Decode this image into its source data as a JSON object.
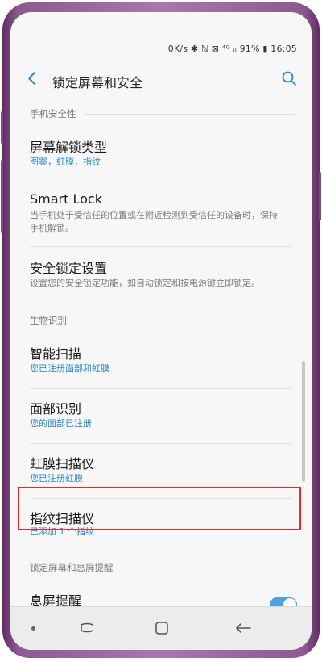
{
  "status_bar": {
    "text": "0K/s ✱ ℕ ⊠ ⁴ᴳ ᵢₗ 91% ▮ 16:05"
  },
  "header": {
    "title": "锁定屏幕和安全"
  },
  "sections": {
    "phone_security": "手机安全性",
    "biometrics": "生物识别",
    "lock_screen": "锁定屏幕和息屏提醒"
  },
  "items": [
    {
      "title": "屏幕解锁类型",
      "subtitle": "图案，虹膜，指纹"
    },
    {
      "title": "Smart Lock",
      "subtitle": "当手机处于受信任的位置或在附近检测到受信任的设备时，保持手机解锁。"
    },
    {
      "title": "安全锁定设置",
      "subtitle": "设置您的安全锁定功能，如自动锁定和按电源键立即锁定。"
    },
    {
      "title": "智能扫描",
      "subtitle": "您已注册面部和虹膜"
    },
    {
      "title": "面部识别",
      "subtitle": "您的面部已注册"
    },
    {
      "title": "虹膜扫描仪",
      "subtitle": "您已注册虹膜"
    },
    {
      "title": "指纹扫描仪",
      "subtitle": "已添加 1 个指纹"
    },
    {
      "title": "息屏提醒",
      "subtitle": ""
    }
  ],
  "aod_toggle": {
    "state": "on"
  },
  "colors": {
    "accent": "#2f86c6",
    "highlight": "#e52b2b",
    "toggle": "#4da2dd",
    "frame": "#a877ab"
  },
  "icons": [
    "back-arrow-icon",
    "search-icon",
    "recents-icon",
    "home-icon",
    "back-icon"
  ]
}
